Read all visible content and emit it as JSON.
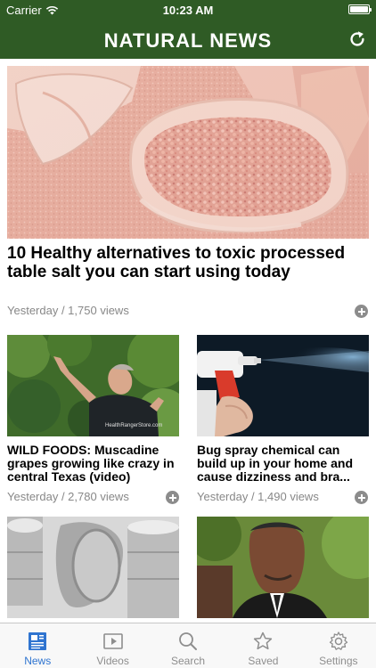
{
  "status_bar": {
    "carrier": "Carrier",
    "time": "10:23 AM",
    "battery_level": 1.0
  },
  "navbar": {
    "title": "NATURAL NEWS",
    "refresh_icon": "refresh-icon"
  },
  "featured": {
    "title": "10 Healthy alternatives to toxic processed table salt you can start using today",
    "meta": "Yesterday / 1,750 views"
  },
  "articles": [
    {
      "title": "WILD FOODS: Muscadine grapes growing like crazy in central Texas (video)",
      "meta": "Yesterday / 2,780 views",
      "image_watermark": "HealthRangerStore.com"
    },
    {
      "title": "Bug spray chemical can build up in your home and cause dizziness and bra...",
      "meta": "Yesterday / 1,490 views"
    }
  ],
  "tabbar": {
    "tabs": [
      {
        "label": "News",
        "icon": "newspaper-icon",
        "active": true
      },
      {
        "label": "Videos",
        "icon": "play-icon",
        "active": false
      },
      {
        "label": "Search",
        "icon": "search-icon",
        "active": false
      },
      {
        "label": "Saved",
        "icon": "star-icon",
        "active": false
      },
      {
        "label": "Settings",
        "icon": "gear-icon",
        "active": false
      }
    ]
  },
  "colors": {
    "brand_green": "#2f5b25",
    "tab_active": "#2f74d0",
    "tab_inactive": "#8e8e8e",
    "meta_gray": "#888888"
  }
}
